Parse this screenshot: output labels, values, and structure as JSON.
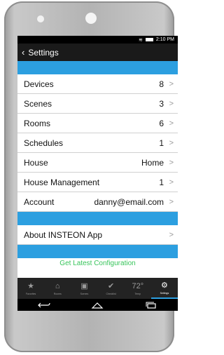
{
  "status": {
    "time": "2:10 PM"
  },
  "header": {
    "title": "Settings"
  },
  "rows": [
    {
      "label": "Devices",
      "value": "8"
    },
    {
      "label": "Scenes",
      "value": "3"
    },
    {
      "label": "Rooms",
      "value": "6"
    },
    {
      "label": "Schedules",
      "value": "1"
    },
    {
      "label": "House",
      "value": "Home"
    },
    {
      "label": "House Management",
      "value": "1"
    },
    {
      "label": "Account",
      "value": "danny@email.com"
    }
  ],
  "about": {
    "label": "About INSTEON App"
  },
  "latest": {
    "label": "Get Latest Configuration"
  },
  "tabs": [
    {
      "icon": "star-icon",
      "label": "Favorites"
    },
    {
      "icon": "home-icon",
      "label": "Rooms"
    },
    {
      "icon": "scenes-icon",
      "label": "Scenes"
    },
    {
      "icon": "checkmark-icon",
      "label": "Checklist"
    },
    {
      "icon": "72°",
      "label": "Temp"
    },
    {
      "icon": "gear-icon",
      "label": "Settings"
    }
  ],
  "colors": {
    "accent": "#2c9fe0",
    "latest": "#37c45a"
  }
}
